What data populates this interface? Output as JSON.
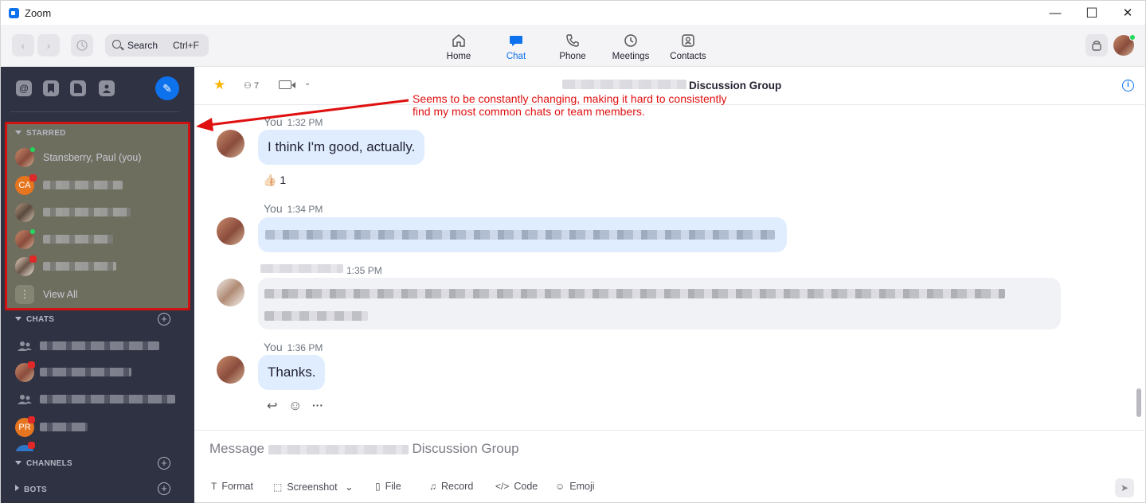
{
  "window": {
    "title": "Zoom",
    "minimize": "—",
    "maximize": "☐",
    "close": "✕"
  },
  "toolbar": {
    "back": "‹",
    "forward": "›",
    "search_label": "Search",
    "search_shortcut": "Ctrl+F",
    "tabs": [
      {
        "label": "Home",
        "icon": "home-icon"
      },
      {
        "label": "Chat",
        "icon": "chat-icon",
        "active": true
      },
      {
        "label": "Phone",
        "icon": "phone-icon"
      },
      {
        "label": "Meetings",
        "icon": "clock-icon"
      },
      {
        "label": "Contacts",
        "icon": "contacts-icon"
      }
    ]
  },
  "sidebar": {
    "top_icons": [
      "@",
      "",
      "",
      ""
    ],
    "compose_icon": "✎",
    "starred": {
      "header": "STARRED",
      "items": [
        {
          "name": "Stansberry, Paul (you)"
        },
        {
          "initials": "CA"
        },
        {},
        {},
        {}
      ],
      "view_all": "View All",
      "more_glyph": "⋮"
    },
    "chats_header": "CHATS",
    "chats": [
      {},
      {},
      {},
      {
        "initials": "PR"
      }
    ],
    "channels_header": "CHANNELS",
    "bots_header": "BOTS",
    "plus": "+"
  },
  "chat_header": {
    "star": "★",
    "member_count": "7",
    "member_glyph": "⚇",
    "chevron": "⌄",
    "group_name": "Discussion Group",
    "info": "i"
  },
  "messages": [
    {
      "sender": "You",
      "time": "1:32 PM",
      "text": "I think I'm good, actually.",
      "reaction": {
        "emoji": "👍🏻",
        "count": "1"
      }
    },
    {
      "sender": "You",
      "time": "1:34 PM"
    },
    {
      "time": "1:35 PM"
    },
    {
      "sender": "You",
      "time": "1:36 PM",
      "text": "Thanks."
    }
  ],
  "message_actions": [
    "↩",
    "☺",
    "···"
  ],
  "composer": {
    "placeholder_prefix": "Message",
    "placeholder_suffix": "Discussion Group",
    "tools": [
      {
        "label": "Format",
        "icon": "format-icon",
        "glyph": "T"
      },
      {
        "label": "Screenshot",
        "icon": "screenshot-icon",
        "glyph": "⬚",
        "chevron": "⌄"
      },
      {
        "label": "File",
        "icon": "file-icon",
        "glyph": "▯"
      },
      {
        "label": "Record",
        "icon": "microphone-icon",
        "glyph": "♫"
      },
      {
        "label": "Code",
        "icon": "code-icon",
        "glyph": "</>"
      },
      {
        "label": "Emoji",
        "icon": "emoji-icon",
        "glyph": "☺"
      }
    ],
    "send_glyph": "➤"
  },
  "annotation": {
    "line1": "Seems to be constantly changing, making it hard to consistently",
    "line2": "find my most common chats or team members.",
    "color": "#e01010"
  }
}
